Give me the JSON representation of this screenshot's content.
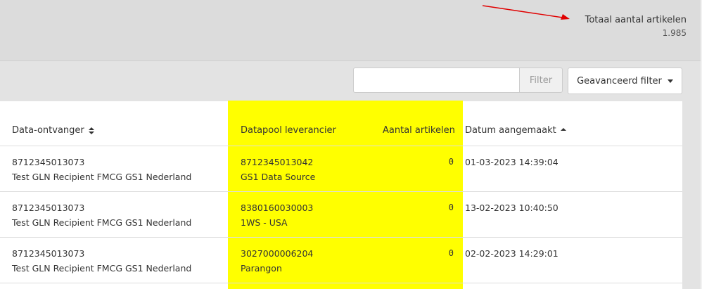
{
  "summary": {
    "total_label": "Totaal aantal artikelen",
    "total_value": "1.985"
  },
  "filter": {
    "input_value": "",
    "filter_button": "Filter",
    "advanced_button": "Geavanceerd filter"
  },
  "table": {
    "headers": {
      "recipient": "Data-ontvanger",
      "datapool": "Datapool leverancier",
      "count": "Aantal artikelen",
      "created": "Datum aangemaakt"
    },
    "rows": [
      {
        "recipient_gln": "8712345013073",
        "recipient_name": "Test GLN Recipient FMCG GS1 Nederland",
        "datapool_gln": "8712345013042",
        "datapool_name": "GS1 Data Source",
        "count": "0",
        "created": "01-03-2023 14:39:04"
      },
      {
        "recipient_gln": "8712345013073",
        "recipient_name": "Test GLN Recipient FMCG GS1 Nederland",
        "datapool_gln": "8380160030003",
        "datapool_name": "1WS - USA",
        "count": "0",
        "created": "13-02-2023 10:40:50"
      },
      {
        "recipient_gln": "8712345013073",
        "recipient_name": "Test GLN Recipient FMCG GS1 Nederland",
        "datapool_gln": "3027000006204",
        "datapool_name": "Parangon",
        "count": "0",
        "created": "02-02-2023 14:29:01"
      }
    ]
  },
  "colors": {
    "highlight": "#ffff00",
    "arrow": "#e00000"
  }
}
